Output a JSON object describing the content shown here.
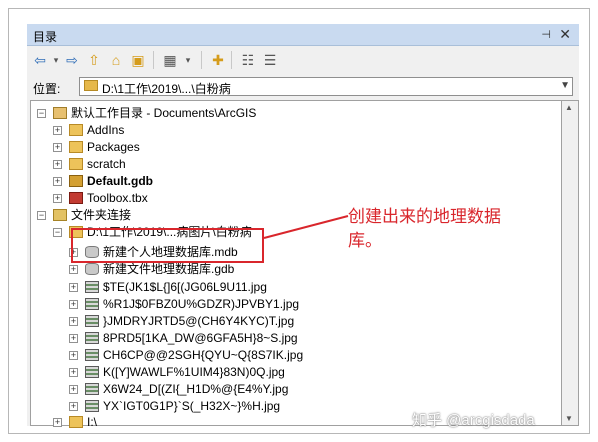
{
  "window": {
    "title": "目录",
    "close": "✕",
    "pin": "⊣"
  },
  "toolbar": {
    "icons": [
      "back-icon",
      "forward-icon",
      "up-icon",
      "home-icon",
      "connect-folder-icon",
      "view-icon",
      "dropdown-icon",
      "new-icon",
      "tree-icon",
      "options-icon"
    ]
  },
  "location": {
    "label": "位置:",
    "value": "D:\\1工作\\2019\\...\\白粉病"
  },
  "tree": {
    "home": {
      "label": "默认工作目录 - Documents\\ArcGIS"
    },
    "home_children": [
      "AddIns",
      "Packages",
      "scratch",
      "Default.gdb",
      "Toolbox.tbx"
    ],
    "connections": {
      "label": "文件夹连接"
    },
    "folder": {
      "label": "D:\\1工作\\2019\\...病图片\\白粉病"
    },
    "gdbs": [
      "新建个人地理数据库.mdb",
      "新建文件地理数据库.gdb"
    ],
    "images": [
      "$TE(JK1$L{]6[(JG06L9U11.jpg",
      "%R1J$0FBZ0U%GDZR)JPVBY1.jpg",
      "}JMDRYJRTD5@(CH6Y4KYC)T.jpg",
      "8PRD5[1KA_DW@6GFA5H}8~S.jpg",
      "CH6CP@@2SGH{QYU~Q{8S7IK.jpg",
      "K([Y]WAWLF%1UIM4}83N)0Q.jpg",
      "X6W24_D[(ZI{_H1D%@{E4%Y.jpg",
      "YX`IGT0G1P}`S(_H32X~}%H.jpg"
    ],
    "drive": {
      "label": "I:\\"
    }
  },
  "annotation": {
    "text": "创建出来的地理数据库。",
    "color": "#d9262c"
  },
  "watermark": "知乎 @arcgisdada"
}
